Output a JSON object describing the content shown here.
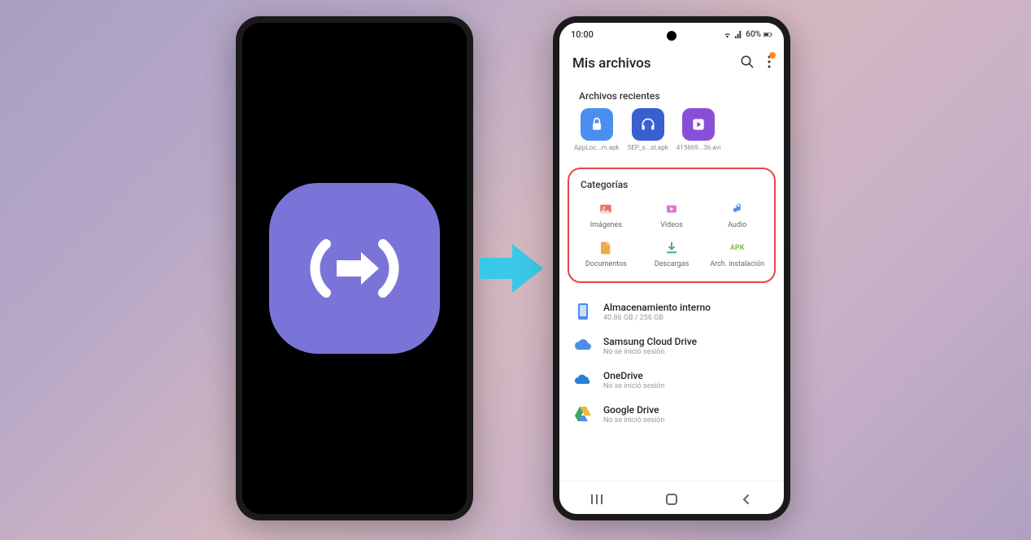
{
  "status": {
    "time": "10:00",
    "battery": "60%"
  },
  "header": {
    "title": "Mis archivos"
  },
  "recent": {
    "title": "Archivos recientes",
    "items": [
      {
        "name": "AppLoc...m.apk"
      },
      {
        "name": "SEP_s...st.apk"
      },
      {
        "name": "415669...36.avi"
      }
    ]
  },
  "categories": {
    "title": "Categorías",
    "items": [
      {
        "label": "Imágenes"
      },
      {
        "label": "Vídeos"
      },
      {
        "label": "Audio"
      },
      {
        "label": "Documentos"
      },
      {
        "label": "Descargas"
      },
      {
        "label": "Arch. instalación"
      }
    ]
  },
  "storage": {
    "items": [
      {
        "name": "Almacenamiento interno",
        "sub": "40.86 GB / 256 GB"
      },
      {
        "name": "Samsung Cloud Drive",
        "sub": "No se inició sesión"
      },
      {
        "name": "OneDrive",
        "sub": "No se inició sesión"
      },
      {
        "name": "Google Drive",
        "sub": "No se inició sesión"
      }
    ]
  }
}
